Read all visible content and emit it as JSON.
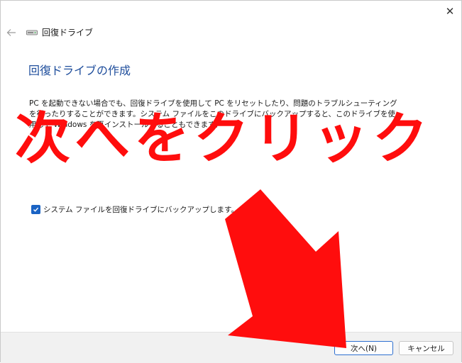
{
  "window": {
    "title": "回復ドライブ",
    "icon": "drive-icon",
    "close_glyph": "✕",
    "back_glyph": "←"
  },
  "main": {
    "heading": "回復ドライブの作成",
    "description": "PC を起動できない場合でも、回復ドライブを使用して PC をリセットしたり、問題のトラブルシューティングを行ったりすることができます。システム ファイルをこのドライブにバックアップすると、このドライブを使用して Windows を再インストールすることもできます。",
    "checkbox": {
      "label": "システム ファイルを回復ドライブにバックアップします。",
      "checked": true
    }
  },
  "annotation": {
    "text": "次へをクリック",
    "color": "#ff0d0d"
  },
  "footer": {
    "next_label": "次へ(N)",
    "cancel_label": "キャンセル"
  },
  "colors": {
    "heading": "#1f4e9c",
    "accent": "#1a63c4",
    "footer_bg": "#f1f1f1"
  }
}
